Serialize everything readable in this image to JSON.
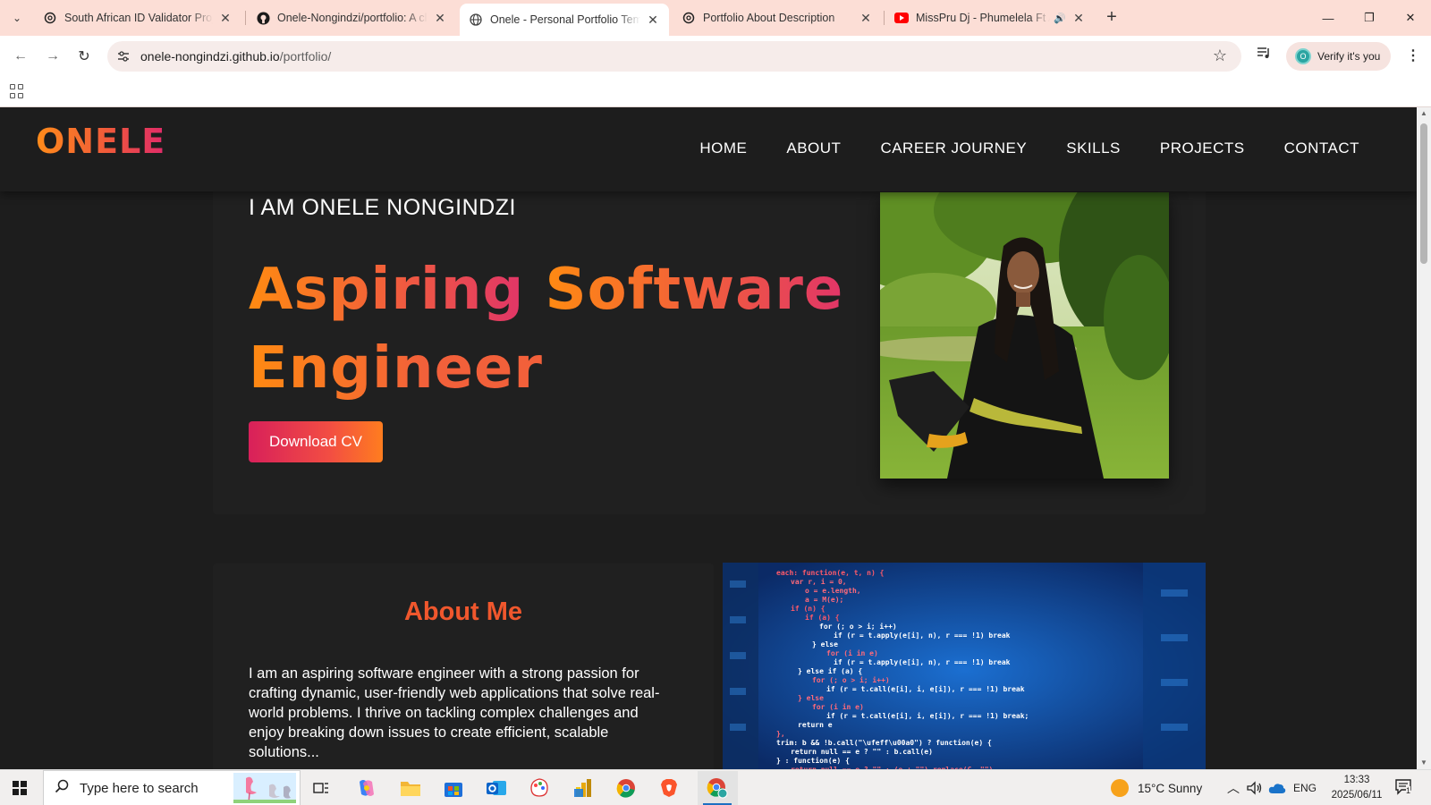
{
  "browser": {
    "tabs": [
      {
        "title": "South African ID Validator Proje",
        "favicon": "chatgpt-icon",
        "active": false
      },
      {
        "title": "Onele-Nongindzi/portfolio: A cl",
        "favicon": "github-icon",
        "active": false
      },
      {
        "title": "Onele - Personal Portfolio Temp",
        "favicon": "globe-icon",
        "active": true
      },
      {
        "title": "Portfolio About Description",
        "favicon": "chatgpt-icon",
        "active": false
      },
      {
        "title": "MissPru Dj - Phumelela Ft A",
        "favicon": "youtube-icon",
        "active": false
      }
    ],
    "url_host": "onele-nongindzi.github.io",
    "url_path": "/portfolio/",
    "profile_label": "Verify it's you",
    "profile_initial": "O"
  },
  "site": {
    "logo": "ONELE",
    "nav": [
      "HOME",
      "ABOUT",
      "CAREER JOURNEY",
      "SKILLS",
      "PROJECTS",
      "CONTACT"
    ],
    "hero": {
      "intro": "I AM ONELE NONGINDZI",
      "title_line1_word1": "Aspiring",
      "title_line1_word2": "Software",
      "title_line2": "Engineer",
      "cv_button": "Download CV"
    },
    "about": {
      "title": "About Me",
      "text": "I am an aspiring software engineer with a strong passion for crafting dynamic, user-friendly web applications that solve real-world problems. I thrive on tackling complex challenges and enjoy breaking down issues to create efficient, scalable solutions..."
    },
    "colors": {
      "accent_orange": "#ff8a12",
      "accent_red": "#f0572d",
      "accent_pink": "#e13568",
      "background": "#1d1d1d"
    }
  },
  "taskbar": {
    "search_placeholder": "Type here to search",
    "weather": "15°C  Sunny",
    "language": "ENG",
    "time": "13:33",
    "date": "2025/06/11",
    "notification_count": "1"
  }
}
